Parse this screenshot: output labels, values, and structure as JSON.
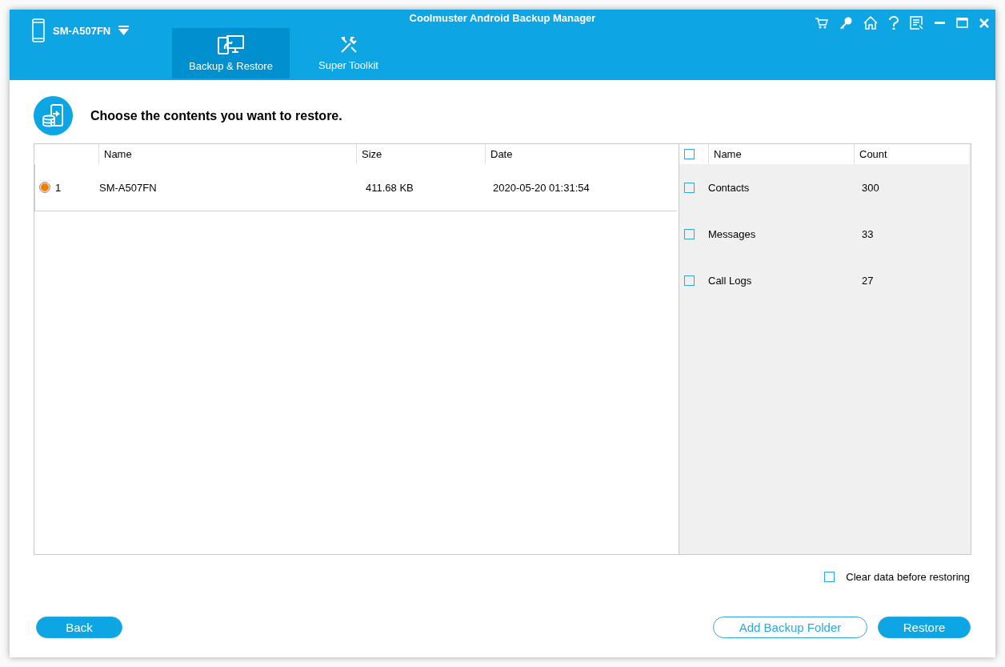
{
  "window": {
    "title": "Coolmuster Android Backup Manager"
  },
  "device": {
    "name": "SM-A507FN"
  },
  "nav_tabs": [
    {
      "label": "Backup & Restore",
      "selected": true,
      "kind": "backup"
    },
    {
      "label": "Super Toolkit",
      "selected": false,
      "kind": "toolkit"
    }
  ],
  "heading": "Choose the contents you want to restore.",
  "backups": {
    "columns": [
      "Name",
      "Size",
      "Date"
    ],
    "rows": [
      {
        "index": "1",
        "name": "SM-A507FN",
        "size": "411.68 KB",
        "date": "2020-05-20 01:31:54",
        "selected": true
      }
    ]
  },
  "contents": {
    "all_checked": false,
    "columns": [
      "Name",
      "Count"
    ],
    "rows": [
      {
        "name": "Contacts",
        "count": "300",
        "checked": false
      },
      {
        "name": "Messages",
        "count": "33",
        "checked": false
      },
      {
        "name": "Call Logs",
        "count": "27",
        "checked": false
      }
    ]
  },
  "clear_data": {
    "label": "Clear data before restoring",
    "checked": false
  },
  "buttons": {
    "back": "Back",
    "add_folder": "Add Backup Folder",
    "restore": "Restore"
  }
}
